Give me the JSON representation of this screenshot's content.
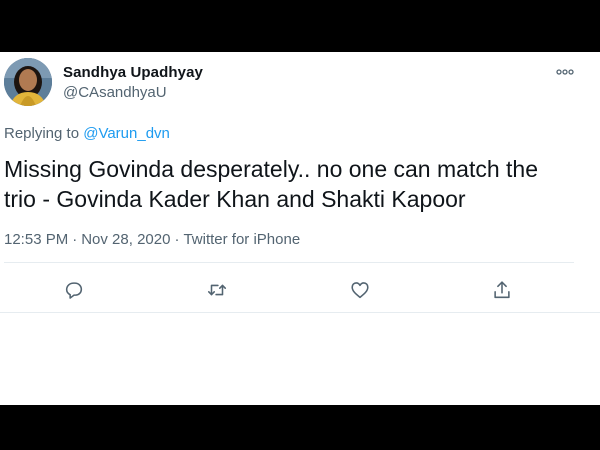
{
  "tweet": {
    "author": {
      "name": "Sandhya Upadhyay",
      "handle": "@CAsandhyaU"
    },
    "replying": {
      "prefix": "Replying to",
      "target": "@Varun_dvn"
    },
    "text_line1": "Missing Govinda desperately.. no one can match the",
    "text_line2": "trio - Govinda Kader Khan and Shakti Kapoor",
    "time": "12:53 PM",
    "date": "Nov 28, 2020",
    "source": "Twitter for iPhone",
    "separator": "·"
  },
  "actions": {
    "reply_icon": "reply-icon",
    "retweet_icon": "retweet-icon",
    "like_icon": "heart-icon",
    "share_icon": "share-icon",
    "more_icon": "more-options-icon"
  },
  "colors": {
    "text": "#0f1419",
    "secondary": "#536471",
    "link": "#1d9bf0",
    "divider": "#e6ecf0"
  }
}
